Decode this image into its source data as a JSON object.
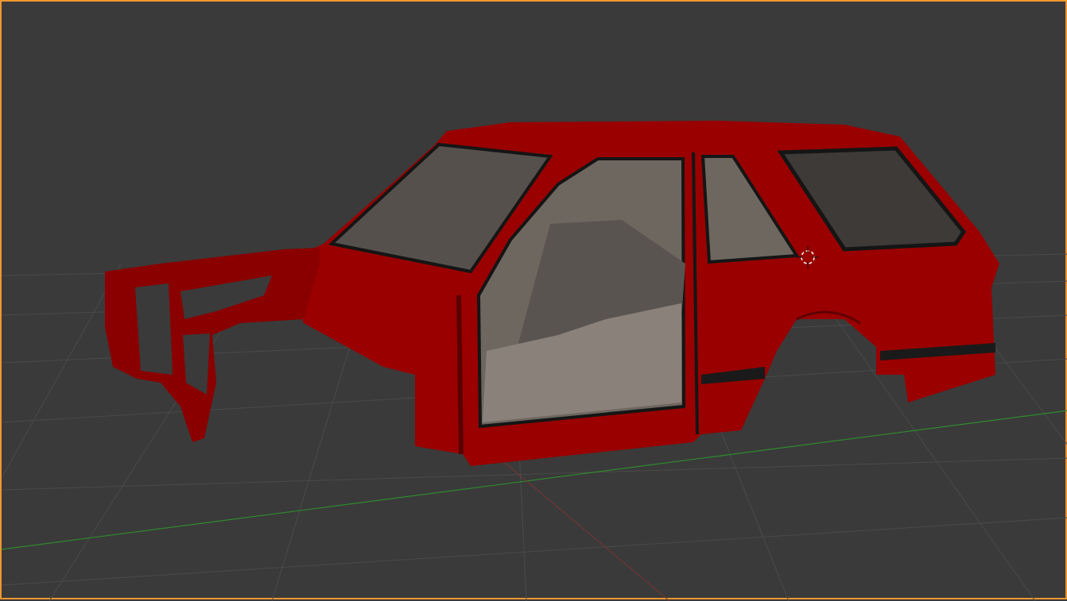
{
  "viewport": {
    "border_color": "#f0972e",
    "background_color": "#3a3a3a",
    "grid_color": "#4a4a4a",
    "x_axis_color": "#2f8a2f",
    "y_axis_color": "#7a3434",
    "model_color": "#a00000",
    "interior_color": "#6e6760",
    "cursor_icon": "3d-cursor-icon"
  }
}
